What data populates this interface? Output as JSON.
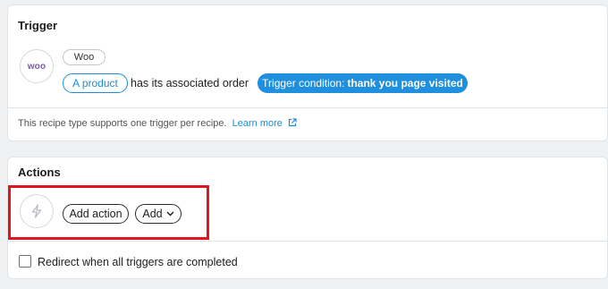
{
  "trigger": {
    "title": "Trigger",
    "integration_logo_text": "woo",
    "integration_tag": "Woo",
    "subject_pill": "A product",
    "sentence": "has its associated order",
    "condition_prefix": "Trigger condition:",
    "condition_value": "thank you page visited",
    "note": "This recipe type supports one trigger per recipe.",
    "learn_more": "Learn more"
  },
  "actions": {
    "title": "Actions",
    "add_action_label": "Add action",
    "add_label": "Add",
    "redirect_label": "Redirect when all triggers are completed",
    "redirect_checked": false
  },
  "colors": {
    "accent": "#1f8fde",
    "highlight": "#e3141c",
    "woo_purple": "#7f54b3"
  },
  "icons": [
    "woo-logo-icon",
    "external-link-icon",
    "bolt-icon",
    "chevron-down-icon"
  ]
}
